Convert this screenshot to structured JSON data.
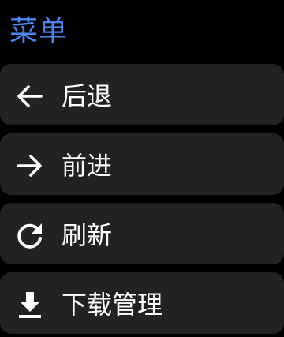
{
  "header": {
    "title": "菜单"
  },
  "menu": {
    "items": [
      {
        "label": "后退",
        "icon": "arrow-left-icon"
      },
      {
        "label": "前进",
        "icon": "arrow-right-icon"
      },
      {
        "label": "刷新",
        "icon": "refresh-icon"
      },
      {
        "label": "下载管理",
        "icon": "download-icon"
      }
    ]
  },
  "colors": {
    "background": "#000000",
    "title": "#4a86f0",
    "item_background": "#222222",
    "text": "#ffffff"
  }
}
